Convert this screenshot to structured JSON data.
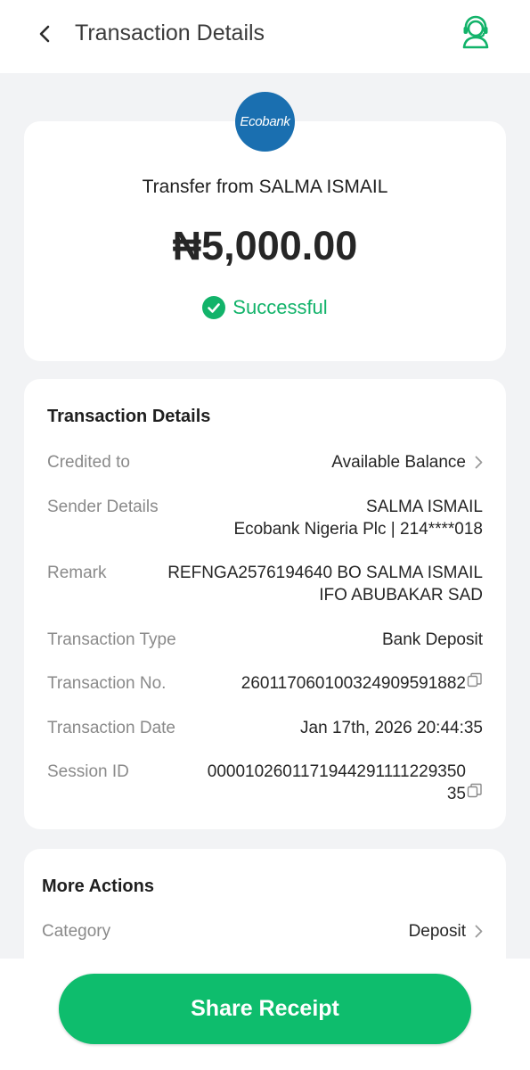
{
  "header": {
    "title": "Transaction Details",
    "back_icon": "chevron-left-icon",
    "support_icon": "headset-support-icon"
  },
  "summary": {
    "bank_logo_text": "Ecobank",
    "transfer_title": "Transfer from SALMA ISMAIL",
    "amount": "₦5,000.00",
    "status": "Successful",
    "status_color": "#12b36a"
  },
  "details": {
    "title": "Transaction Details",
    "credited_to": {
      "label": "Credited to",
      "value": "Available Balance"
    },
    "sender": {
      "label": "Sender Details",
      "line1": "SALMA ISMAIL",
      "line2": "Ecobank Nigeria Plc | 214****018"
    },
    "remark": {
      "label": "Remark",
      "line1": "REFNGA2576194640 BO SALMA ISMAIL",
      "line2": "IFO ABUBAKAR SAD"
    },
    "type": {
      "label": "Transaction Type",
      "value": "Bank Deposit"
    },
    "number": {
      "label": "Transaction No.",
      "value": "260117060100324909591882"
    },
    "date": {
      "label": "Transaction Date",
      "value": "Jan 17th, 2026 20:44:35"
    },
    "session": {
      "label": "Session ID",
      "line1": "000010260117194429111122935 0",
      "line1_display": "0000102601171944291111229350",
      "line2": "35"
    }
  },
  "actions": {
    "title": "More Actions",
    "category": {
      "label": "Category",
      "value": "Deposit"
    }
  },
  "share_button": {
    "label": "Share Receipt"
  },
  "colors": {
    "accent": "#0ebd6d",
    "bank_blue": "#1a6fb0"
  }
}
